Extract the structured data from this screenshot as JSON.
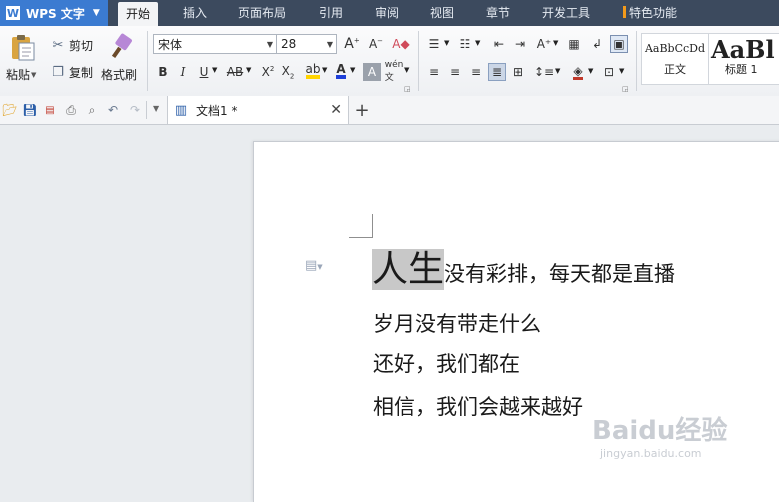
{
  "app": {
    "name": "WPS 文字"
  },
  "menu": {
    "tabs": [
      {
        "label": "开始"
      },
      {
        "label": "插入"
      },
      {
        "label": "页面布局"
      },
      {
        "label": "引用"
      },
      {
        "label": "审阅"
      },
      {
        "label": "视图"
      },
      {
        "label": "章节"
      },
      {
        "label": "开发工具"
      },
      {
        "label": "特色功能"
      }
    ],
    "active_tab": "开始"
  },
  "ribbon": {
    "clipboard": {
      "paste": "粘贴",
      "cut": "剪切",
      "copy": "复制",
      "format_painter": "格式刷"
    },
    "font": {
      "name": "宋体",
      "size": "28"
    },
    "styles": {
      "normal_preview": "AaBbCcDd",
      "normal_label": "正文",
      "heading1_preview": "AaBl",
      "heading1_label": "标题 1"
    }
  },
  "document": {
    "tab_title": "文档1 *",
    "lines": [
      {
        "selected": "人生",
        "rest": "没有彩排，每天都是直播"
      },
      {
        "text": "岁月没有带走什么"
      },
      {
        "text": "还好，我们都在"
      },
      {
        "text": "相信，我们会越来越好"
      }
    ]
  },
  "watermark": {
    "text": "Baidu经验",
    "sub": "jingyan.baidu.com"
  },
  "colors": {
    "menubar_bg": "#3c4a5e",
    "app_button": "#3b7bd1",
    "selection": "#c8c8c8",
    "accent_orange": "#f39a1b"
  }
}
